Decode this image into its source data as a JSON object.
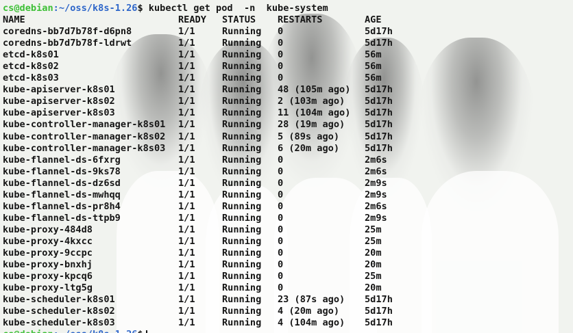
{
  "prompt": {
    "user_host": "cs@debian",
    "path": ":~/oss/k8s-1.26",
    "symbol": "$",
    "command": " kubectl get pod  -n  kube-system"
  },
  "headers": [
    "NAME",
    "READY",
    "STATUS",
    "RESTARTS",
    "AGE"
  ],
  "pods": [
    {
      "name": "coredns-bb7d7b78f-d6pn8",
      "ready": "1/1",
      "status": "Running",
      "restarts": "0",
      "age": "5d17h"
    },
    {
      "name": "coredns-bb7d7b78f-ldrwt",
      "ready": "1/1",
      "status": "Running",
      "restarts": "0",
      "age": "5d17h"
    },
    {
      "name": "etcd-k8s01",
      "ready": "1/1",
      "status": "Running",
      "restarts": "0",
      "age": "56m"
    },
    {
      "name": "etcd-k8s02",
      "ready": "1/1",
      "status": "Running",
      "restarts": "0",
      "age": "56m"
    },
    {
      "name": "etcd-k8s03",
      "ready": "1/1",
      "status": "Running",
      "restarts": "0",
      "age": "56m"
    },
    {
      "name": "kube-apiserver-k8s01",
      "ready": "1/1",
      "status": "Running",
      "restarts": "48 (105m ago)",
      "age": "5d17h"
    },
    {
      "name": "kube-apiserver-k8s02",
      "ready": "1/1",
      "status": "Running",
      "restarts": "2 (103m ago)",
      "age": "5d17h"
    },
    {
      "name": "kube-apiserver-k8s03",
      "ready": "1/1",
      "status": "Running",
      "restarts": "11 (104m ago)",
      "age": "5d17h"
    },
    {
      "name": "kube-controller-manager-k8s01",
      "ready": "1/1",
      "status": "Running",
      "restarts": "28 (19m ago)",
      "age": "5d17h"
    },
    {
      "name": "kube-controller-manager-k8s02",
      "ready": "1/1",
      "status": "Running",
      "restarts": "5 (89s ago)",
      "age": "5d17h"
    },
    {
      "name": "kube-controller-manager-k8s03",
      "ready": "1/1",
      "status": "Running",
      "restarts": "6 (20m ago)",
      "age": "5d17h"
    },
    {
      "name": "kube-flannel-ds-6fxrg",
      "ready": "1/1",
      "status": "Running",
      "restarts": "0",
      "age": "2m6s"
    },
    {
      "name": "kube-flannel-ds-9ks78",
      "ready": "1/1",
      "status": "Running",
      "restarts": "0",
      "age": "2m6s"
    },
    {
      "name": "kube-flannel-ds-dz6sd",
      "ready": "1/1",
      "status": "Running",
      "restarts": "0",
      "age": "2m9s"
    },
    {
      "name": "kube-flannel-ds-mwhqq",
      "ready": "1/1",
      "status": "Running",
      "restarts": "0",
      "age": "2m9s"
    },
    {
      "name": "kube-flannel-ds-pr8h4",
      "ready": "1/1",
      "status": "Running",
      "restarts": "0",
      "age": "2m6s"
    },
    {
      "name": "kube-flannel-ds-ttpb9",
      "ready": "1/1",
      "status": "Running",
      "restarts": "0",
      "age": "2m9s"
    },
    {
      "name": "kube-proxy-484d8",
      "ready": "1/1",
      "status": "Running",
      "restarts": "0",
      "age": "25m"
    },
    {
      "name": "kube-proxy-4kxcc",
      "ready": "1/1",
      "status": "Running",
      "restarts": "0",
      "age": "25m"
    },
    {
      "name": "kube-proxy-9ccpc",
      "ready": "1/1",
      "status": "Running",
      "restarts": "0",
      "age": "20m"
    },
    {
      "name": "kube-proxy-bnxhj",
      "ready": "1/1",
      "status": "Running",
      "restarts": "0",
      "age": "20m"
    },
    {
      "name": "kube-proxy-kpcq6",
      "ready": "1/1",
      "status": "Running",
      "restarts": "0",
      "age": "25m"
    },
    {
      "name": "kube-proxy-ltg5g",
      "ready": "1/1",
      "status": "Running",
      "restarts": "0",
      "age": "20m"
    },
    {
      "name": "kube-scheduler-k8s01",
      "ready": "1/1",
      "status": "Running",
      "restarts": "23 (87s ago)",
      "age": "5d17h"
    },
    {
      "name": "kube-scheduler-k8s02",
      "ready": "1/1",
      "status": "Running",
      "restarts": "4 (20m ago)",
      "age": "5d17h"
    },
    {
      "name": "kube-scheduler-k8s03",
      "ready": "1/1",
      "status": "Running",
      "restarts": "4 (104m ago)",
      "age": "5d17h"
    }
  ],
  "colors": {
    "prompt_user": "#3cbf35",
    "prompt_path": "#2e66c9",
    "text": "#151515",
    "background": "#f1f3ef"
  }
}
